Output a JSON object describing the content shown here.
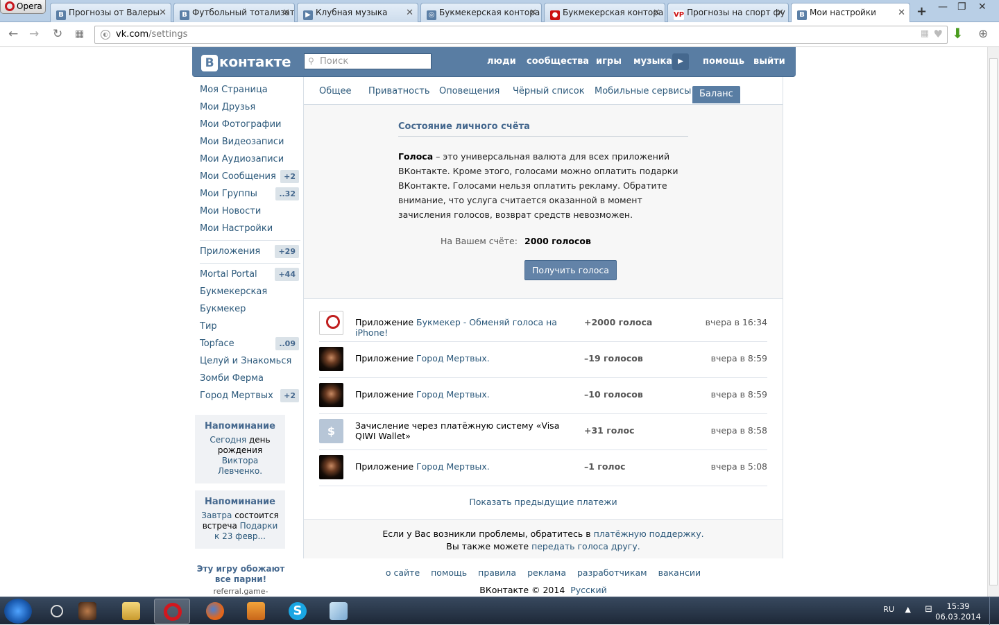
{
  "browser": {
    "opera_label": "Opera",
    "tabs": [
      {
        "label": "Прогнозы от Валеры",
        "fav": "В"
      },
      {
        "label": "Футбольный тотализатор",
        "fav": "В"
      },
      {
        "label": "Клубная музыка",
        "fav": "▶"
      },
      {
        "label": "Букмекерская контора",
        "fav": "◎"
      },
      {
        "label": "Букмекерская контора",
        "fav": "●"
      },
      {
        "label": "Прогнозы на спорт фу",
        "fav": "VP"
      },
      {
        "label": "Мои настройки",
        "fav": "В"
      }
    ],
    "url_domain": "vk.com",
    "url_path": "/settings"
  },
  "vk": {
    "logo_letter": "В",
    "logo_text": "контакте",
    "search_placeholder": "Поиск",
    "topnav": [
      "люди",
      "сообщества",
      "игры",
      "музыка",
      "помощь",
      "выйти"
    ]
  },
  "leftmenu": {
    "main": [
      {
        "label": "Моя Страница",
        "count": ""
      },
      {
        "label": "Мои Друзья",
        "count": ""
      },
      {
        "label": "Мои Фотографии",
        "count": ""
      },
      {
        "label": "Мои Видеозаписи",
        "count": ""
      },
      {
        "label": "Мои Аудиозаписи",
        "count": ""
      },
      {
        "label": "Мои Сообщения",
        "count": "+2"
      },
      {
        "label": "Мои Группы",
        "count": "..32"
      },
      {
        "label": "Мои Новости",
        "count": ""
      },
      {
        "label": "Мои Настройки",
        "count": ""
      }
    ],
    "apps_label": "Приложения",
    "apps_count": "+29",
    "apps": [
      {
        "label": "Mortal Portal",
        "count": "+44"
      },
      {
        "label": "Букмекерская",
        "count": ""
      },
      {
        "label": "Букмекер",
        "count": ""
      },
      {
        "label": "Тир",
        "count": ""
      },
      {
        "label": "Topface",
        "count": "..09"
      },
      {
        "label": "Целуй и Знакомься",
        "count": ""
      },
      {
        "label": "Зомби Ферма",
        "count": ""
      },
      {
        "label": "Город Мертвых",
        "count": "+2"
      }
    ]
  },
  "reminders": [
    {
      "title": "Напоминание",
      "pre": "Сегодня",
      "mid": " день рождения ",
      "link": "Виктора Левченко."
    },
    {
      "title": "Напоминание",
      "pre": "Завтра",
      "mid": " состоится встреча ",
      "link": "Подарки к 23 февр..."
    }
  ],
  "ad": {
    "title": "Эту игру обожают все парни!",
    "url": "referral.game-"
  },
  "settings_tabs": [
    "Общее",
    "Приватность",
    "Оповещения",
    "Чёрный список",
    "Мобильные сервисы",
    "Баланс"
  ],
  "balance": {
    "title": "Состояние личного счёта",
    "desc_bold": "Голоса",
    "desc_rest": " – это универсальная валюта для всех приложений ВКонтакте. Кроме этого, голосами можно оплатить подарки ВКонтакте. Голосами нельзя оплатить рекламу. Обратите внимание, что услуга считается оказанной в момент зачисления голосов, возврат средств невозможен.",
    "account_label": "На Вашем счёте:",
    "account_value": "2000 голосов",
    "get_button": "Получить голоса"
  },
  "history": [
    {
      "icon": "bukmeker-app-icon",
      "prefix": "Приложение ",
      "link": "Букмекер - Обменяй голоса на iPhone!",
      "amount": "+2000 голоса",
      "time": "вчера в 16:34"
    },
    {
      "icon": "gorod-mertvyh-app-icon",
      "prefix": "Приложение ",
      "link": "Город Мертвых.",
      "amount": "–19 голосов",
      "time": "вчера в 8:59"
    },
    {
      "icon": "gorod-mertvyh-app-icon",
      "prefix": "Приложение ",
      "link": "Город Мертвых.",
      "amount": "–10 голосов",
      "time": "вчера в 8:59"
    },
    {
      "icon": "dollar-icon",
      "prefix": "Зачисление через платёжную систему «Visa QIWI Wallet»",
      "link": "",
      "amount": "+31 голос",
      "time": "вчера в 8:58"
    },
    {
      "icon": "gorod-mertvyh-app-icon",
      "prefix": "Приложение ",
      "link": "Город Мертвых.",
      "amount": "–1 голос",
      "time": "вчера в 5:08"
    }
  ],
  "show_previous": "Показать предыдущие платежи",
  "support": {
    "line1_pre": "Если у Вас возникли проблемы, обратитесь в ",
    "line1_link": "платёжную поддержку.",
    "line2_pre": "Вы также можете ",
    "line2_link": "передать голоса другу."
  },
  "footer": {
    "links": [
      "о сайте",
      "помощь",
      "правила",
      "реклама",
      "разработчикам",
      "вакансии"
    ],
    "copyright": "ВКонтакте © 2014",
    "language": "Русский"
  },
  "taskbar": {
    "lang": "RU",
    "time": "15:39",
    "date": "06.03.2014"
  }
}
